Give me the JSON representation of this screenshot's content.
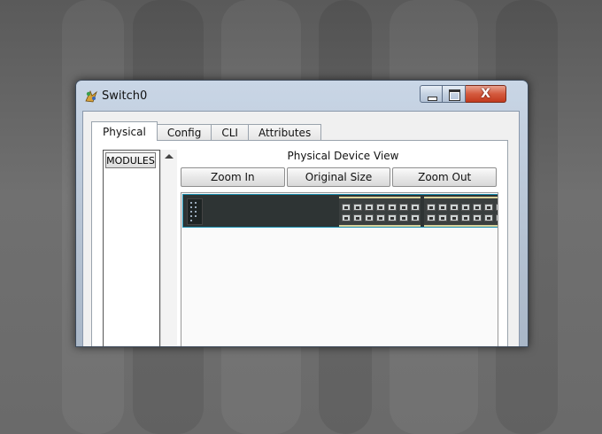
{
  "window": {
    "title": "Switch0",
    "close_symbol": "X"
  },
  "tabs": [
    {
      "label": "Physical",
      "active": true
    },
    {
      "label": "Config",
      "active": false
    },
    {
      "label": "CLI",
      "active": false
    },
    {
      "label": "Attributes",
      "active": false
    }
  ],
  "physical": {
    "modules_label": "MODULES",
    "device_view_title": "Physical Device View",
    "zoom_in_label": "Zoom In",
    "original_size_label": "Original Size",
    "zoom_out_label": "Zoom Out"
  },
  "icons": {
    "app": "packet-tracer-icon",
    "minimize": "minimize-icon",
    "maximize": "maximize-icon",
    "close": "close-icon",
    "scroll_up": "scroll-up-arrow-icon"
  },
  "colors": {
    "close_button": "#c23a1e",
    "chassis": "#2e3434",
    "chassis_border": "#1a8fb0"
  }
}
